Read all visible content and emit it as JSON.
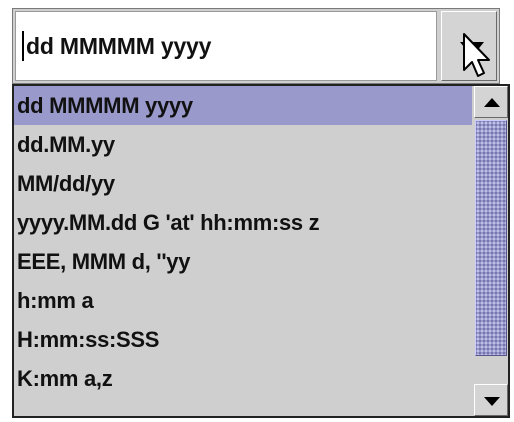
{
  "combo": {
    "value": "dd MMMMM yyyy",
    "button_icon": "down-arrow-icon"
  },
  "list": {
    "items": [
      "dd MMMMM yyyy",
      "dd.MM.yy",
      "MM/dd/yy",
      "yyyy.MM.dd G 'at' hh:mm:ss z",
      "EEE, MMM d, ''yy",
      "h:mm a",
      "H:mm:ss:SSS",
      "K:mm a,z"
    ],
    "selected_index": 0
  },
  "scrollbar": {
    "up_icon": "up-arrow-icon",
    "down_icon": "down-arrow-icon"
  },
  "colors": {
    "selection": "#9999cc",
    "background": "#cfcfcf"
  }
}
